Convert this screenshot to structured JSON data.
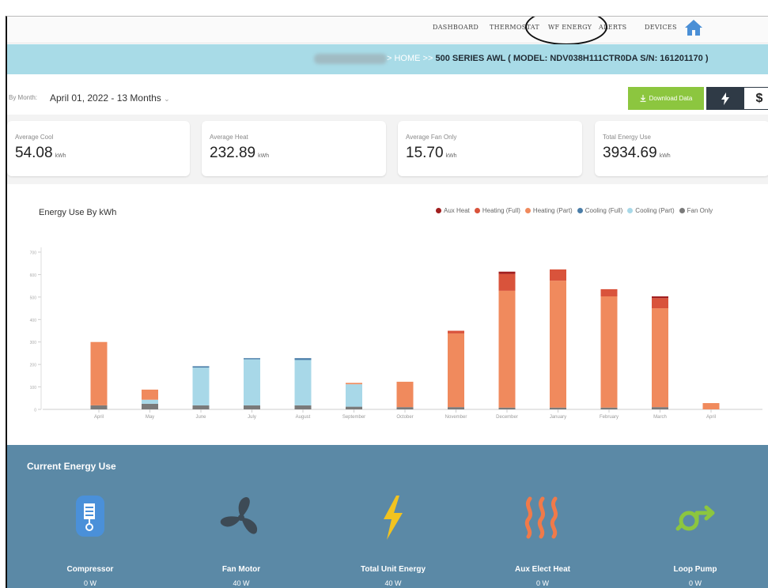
{
  "nav": {
    "items": [
      "DASHBOARD",
      "THERMOSTAT",
      "WF ENERGY",
      "ALERTS",
      "DEVICES"
    ],
    "active": "WF ENERGY"
  },
  "breadcrumb": {
    "home": "HOME",
    "separator": ">>",
    "current": "500 SERIES AWL ( MODEL: NDV038H111CTR0DA S/N: 161201170 )"
  },
  "filter": {
    "label": "By Month:",
    "value": "April 01, 2022 - 13 Months"
  },
  "actions": {
    "download_label": "Download Data",
    "cost_symbol": "$"
  },
  "stats": [
    {
      "label": "Average Cool",
      "value": "54.08",
      "unit": "kWh"
    },
    {
      "label": "Average Heat",
      "value": "232.89",
      "unit": "kWh"
    },
    {
      "label": "Average Fan Only",
      "value": "15.70",
      "unit": "kWh"
    },
    {
      "label": "Total Energy Use",
      "value": "3934.69",
      "unit": "kWh"
    }
  ],
  "chart_data": {
    "type": "bar",
    "stacked": true,
    "title": "Energy Use By kWh",
    "categories": [
      "April",
      "May",
      "June",
      "July",
      "August",
      "September",
      "October",
      "November",
      "December",
      "January",
      "February",
      "March",
      "April"
    ],
    "ylim": [
      0,
      700
    ],
    "yticks": [
      0,
      100,
      200,
      300,
      400,
      500,
      600,
      700
    ],
    "legend_position": "top-right",
    "grid": false,
    "series": [
      {
        "name": "Fan Only",
        "color": "#7a7a7a",
        "values": [
          18,
          25,
          18,
          18,
          18,
          12,
          10,
          10,
          8,
          8,
          8,
          10,
          0
        ]
      },
      {
        "name": "Cooling (Part)",
        "color": "#a8d8e8",
        "values": [
          0,
          18,
          168,
          205,
          202,
          100,
          0,
          0,
          0,
          0,
          0,
          0,
          0
        ]
      },
      {
        "name": "Cooling (Full)",
        "color": "#4a7da8",
        "values": [
          0,
          0,
          6,
          5,
          8,
          0,
          0,
          0,
          0,
          0,
          0,
          0,
          0
        ]
      },
      {
        "name": "Heating (Part)",
        "color": "#f08a5d",
        "values": [
          282,
          45,
          0,
          0,
          0,
          6,
          113,
          328,
          520,
          565,
          495,
          440,
          28
        ]
      },
      {
        "name": "Heating (Full)",
        "color": "#d9533b",
        "values": [
          0,
          0,
          0,
          0,
          0,
          0,
          0,
          12,
          75,
          50,
          32,
          45,
          0
        ]
      },
      {
        "name": "Aux Heat",
        "color": "#a11f1f",
        "values": [
          0,
          0,
          0,
          0,
          0,
          0,
          0,
          0,
          10,
          0,
          0,
          8,
          0
        ]
      }
    ]
  },
  "legend_order": [
    "Aux Heat",
    "Heating (Full)",
    "Heating (Part)",
    "Cooling (Full)",
    "Cooling (Part)",
    "Fan Only"
  ],
  "current_energy": {
    "title": "Current Energy Use",
    "devices": [
      {
        "name": "Compressor",
        "value": "0 W",
        "icon": "compressor-icon"
      },
      {
        "name": "Fan Motor",
        "value": "40 W",
        "icon": "fan-icon"
      },
      {
        "name": "Total Unit Energy",
        "value": "40 W",
        "icon": "lightning-icon"
      },
      {
        "name": "Aux Elect Heat",
        "value": "0 W",
        "icon": "heat-waves-icon"
      },
      {
        "name": "Loop Pump",
        "value": "0 W",
        "icon": "pump-icon"
      }
    ]
  }
}
